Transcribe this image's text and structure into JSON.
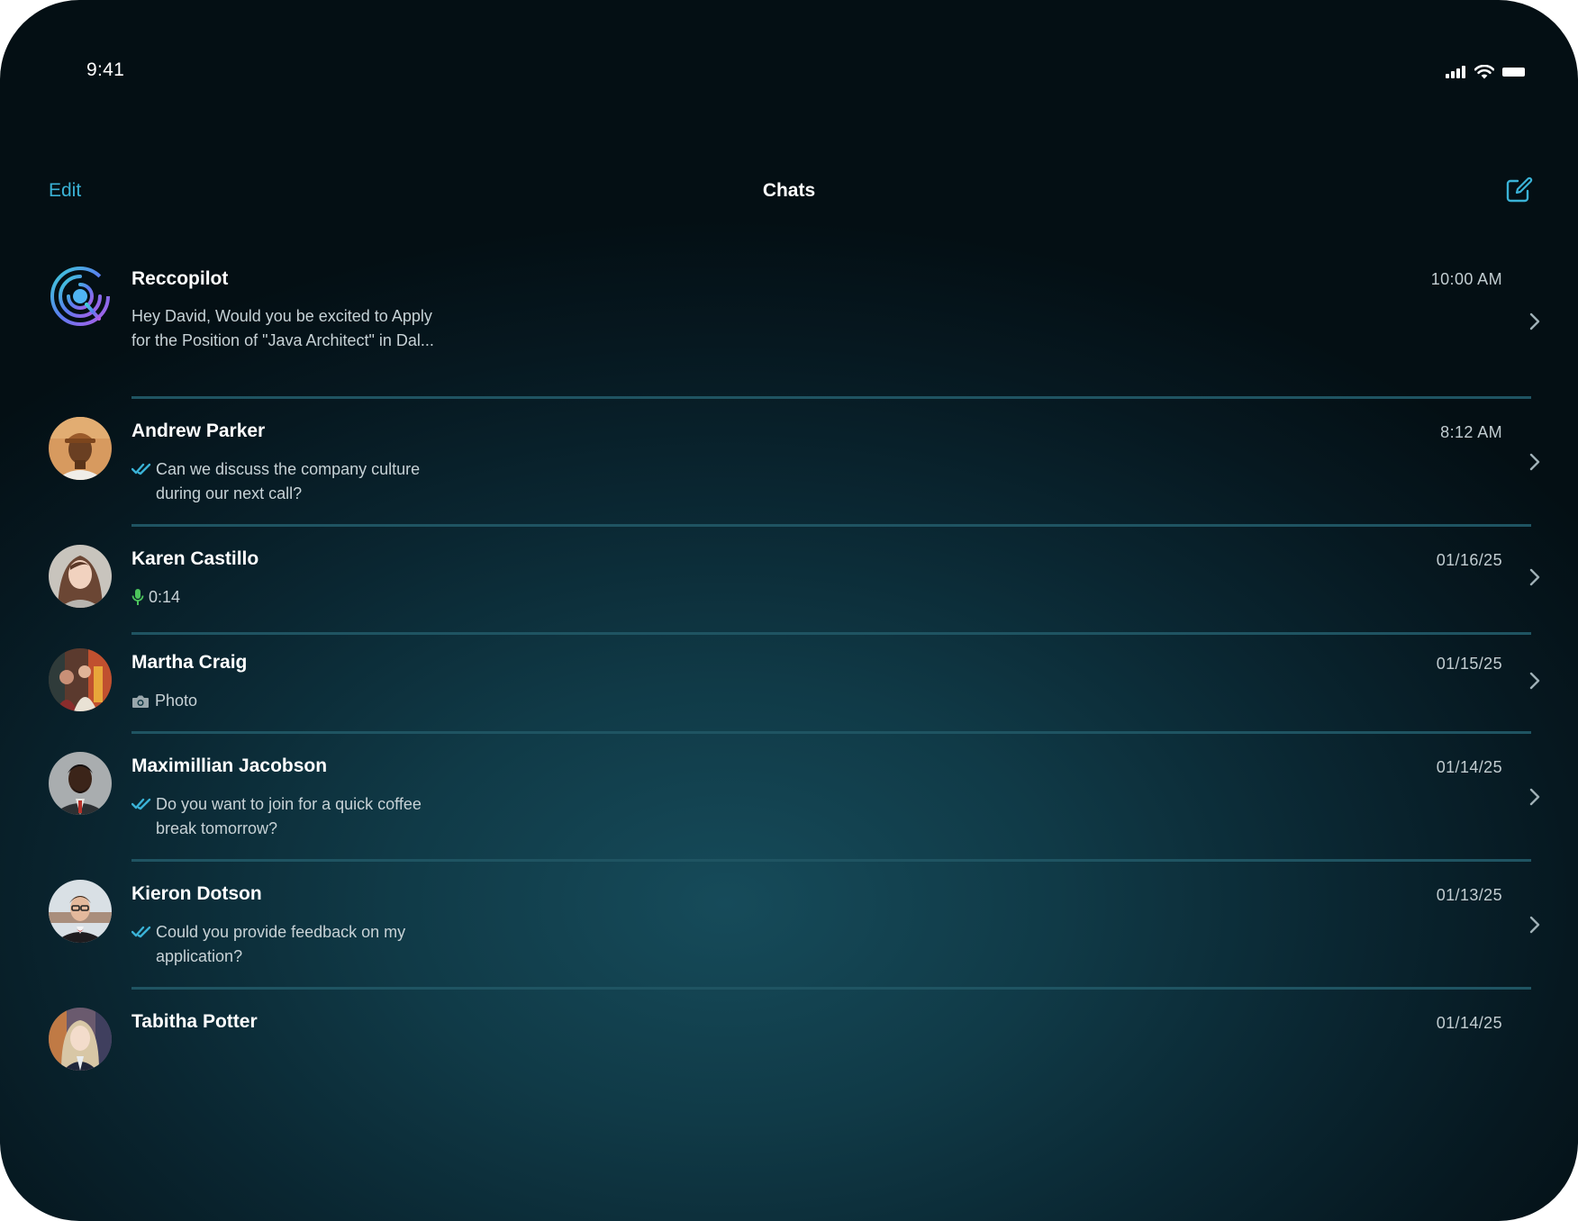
{
  "status_bar": {
    "time": "9:41"
  },
  "nav": {
    "edit_label": "Edit",
    "title": "Chats",
    "compose_icon": "compose-icon"
  },
  "colors": {
    "accent": "#3ab2d6",
    "mic_green": "#4cc45c",
    "background_center": "#164b5a",
    "background_edge": "#040f14"
  },
  "chats": [
    {
      "name": "Reccopilot",
      "time": "10:00 AM",
      "preview": "Hey David, Would you be excited to Apply for the Position of \"Java Architect\" in Dal...",
      "lead_icon": null,
      "avatar": "reccopilot-logo"
    },
    {
      "name": "Andrew Parker",
      "time": "8:12 AM",
      "preview": "Can we discuss the company culture during our next call?",
      "lead_icon": "double-check-icon",
      "avatar": "andrew-parker-photo"
    },
    {
      "name": "Karen Castillo",
      "time": "01/16/25",
      "preview": "0:14",
      "lead_icon": "microphone-icon",
      "avatar": "karen-castillo-photo"
    },
    {
      "name": "Martha Craig",
      "time": "01/15/25",
      "preview": "Photo",
      "lead_icon": "camera-icon",
      "avatar": "martha-craig-photo"
    },
    {
      "name": "Maximillian Jacobson",
      "time": "01/14/25",
      "preview": "Do you want to join for a quick coffee break tomorrow?",
      "lead_icon": "double-check-icon",
      "avatar": "maximillian-jacobson-photo"
    },
    {
      "name": "Kieron Dotson",
      "time": "01/13/25",
      "preview": "Could you provide feedback on my application?",
      "lead_icon": "double-check-icon",
      "avatar": "kieron-dotson-photo"
    },
    {
      "name": "Tabitha Potter",
      "time": "01/14/25",
      "preview": "",
      "lead_icon": null,
      "avatar": "tabitha-potter-photo"
    }
  ]
}
